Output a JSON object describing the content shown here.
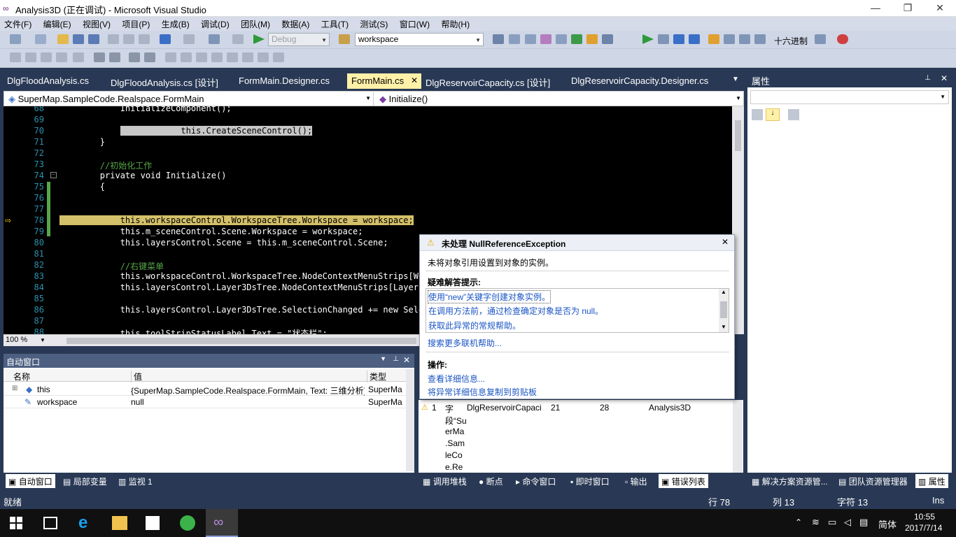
{
  "window": {
    "title": "Analysis3D (正在调试) - Microsoft Visual Studio",
    "minimize": "—",
    "restore": "❐",
    "close": "✕"
  },
  "menu": [
    "文件(F)",
    "编辑(E)",
    "视图(V)",
    "项目(P)",
    "生成(B)",
    "调试(D)",
    "团队(M)",
    "数据(A)",
    "工具(T)",
    "测试(S)",
    "窗口(W)",
    "帮助(H)"
  ],
  "toolbar": {
    "config": "Debug",
    "startup": "workspace",
    "hex_label": "十六进制"
  },
  "doc_tabs": [
    {
      "label": "DlgFloodAnalysis.cs",
      "active": false
    },
    {
      "label": "DlgFloodAnalysis.cs [设计]",
      "active": false
    },
    {
      "label": "FormMain.Designer.cs",
      "active": false
    },
    {
      "label": "FormMain.cs",
      "active": true
    },
    {
      "label": "DlgReservoirCapacity.cs [设计]",
      "active": false
    },
    {
      "label": "DlgReservoirCapacity.Designer.cs",
      "active": false
    }
  ],
  "nav": {
    "class": "SuperMap.SampleCode.Realspace.FormMain",
    "member": "Initialize()"
  },
  "editor": {
    "zoom": "100 %",
    "lines": [
      {
        "n": "68",
        "t": "            InitializeComponent();"
      },
      {
        "n": "69",
        "t": ""
      },
      {
        "n": "70",
        "t": "            this.CreateSceneControl();"
      },
      {
        "n": "71",
        "t": "        }"
      },
      {
        "n": "72",
        "t": ""
      },
      {
        "n": "73",
        "t": "        //初始化工作"
      },
      {
        "n": "74",
        "t": "        private void Initialize()"
      },
      {
        "n": "75",
        "t": "        {"
      },
      {
        "n": "76",
        "t": ""
      },
      {
        "n": "77",
        "t": ""
      },
      {
        "n": "78",
        "t": "            this.workspaceControl.WorkspaceTree.Workspace = workspace;"
      },
      {
        "n": "79",
        "t": "            this.m_sceneControl.Scene.Workspace = workspace;"
      },
      {
        "n": "80",
        "t": "            this.layersControl.Scene = this.m_sceneControl.Scene;"
      },
      {
        "n": "81",
        "t": ""
      },
      {
        "n": "82",
        "t": "            //右键菜单"
      },
      {
        "n": "83",
        "t": "            this.workspaceControl.WorkspaceTree.NodeContextMenuStrips[Wo"
      },
      {
        "n": "84",
        "t": "            this.layersControl.Layer3DsTree.NodeContextMenuStrips[Layer3"
      },
      {
        "n": "85",
        "t": ""
      },
      {
        "n": "86",
        "t": "            this.layersControl.Layer3DsTree.SelectionChanged += new Sele"
      },
      {
        "n": "87",
        "t": ""
      },
      {
        "n": "88",
        "t": "            this.toolStripStatusLabel.Text = \"状态栏\";"
      }
    ]
  },
  "exception": {
    "title": "未处理 NullReferenceException",
    "message": "未将对象引用设置到对象的实例。",
    "tips_header": "疑难解答提示:",
    "tips": [
      "使用“new”关键字创建对象实例。",
      "在调用方法前，通过检查确定对象是否为 null。",
      "获取此异常的常规帮助。"
    ],
    "search_more": "搜索更多联机帮助...",
    "actions_header": "操作:",
    "actions": [
      "查看详细信息...",
      "将异常详细信息复制到剪贴板"
    ]
  },
  "properties": {
    "title": "属性"
  },
  "autos": {
    "title": "自动窗口",
    "columns": [
      "名称",
      "值",
      "类型"
    ],
    "rows": [
      {
        "name": "this",
        "value": "{SuperMap.SampleCode.Realspace.FormMain, Text: 三维分析}",
        "type": "SuperMa"
      },
      {
        "name": "workspace",
        "value": "null",
        "type": "SuperMa"
      }
    ]
  },
  "error_list": {
    "row": {
      "num": "1",
      "desc": [
        "字",
        "段“Su",
        "erMa",
        ".Sam",
        "leCo",
        "e.Re"
      ],
      "file": "DlgReservoirCapaci",
      "line": "21",
      "col": "28",
      "project": "Analysis3D"
    }
  },
  "bottom_tabs_left": [
    "自动窗口",
    "局部变量",
    "监视 1"
  ],
  "bottom_tabs_mid": [
    "调用堆栈",
    "断点",
    "命令窗口",
    "即时窗口",
    "输出",
    "错误列表"
  ],
  "bottom_tabs_right": [
    "解决方案资源管...",
    "团队资源管理器",
    "属性"
  ],
  "status": {
    "ready": "就绪",
    "row": "行 78",
    "col": "列 13",
    "char": "字符 13",
    "ins": "Ins"
  },
  "taskbar": {
    "lang": "简体",
    "time": "10:55",
    "date": "2017/7/14"
  },
  "colors": {
    "chrome": "#293955",
    "active_tab": "#fff1a8",
    "code_bg": "#000000"
  }
}
